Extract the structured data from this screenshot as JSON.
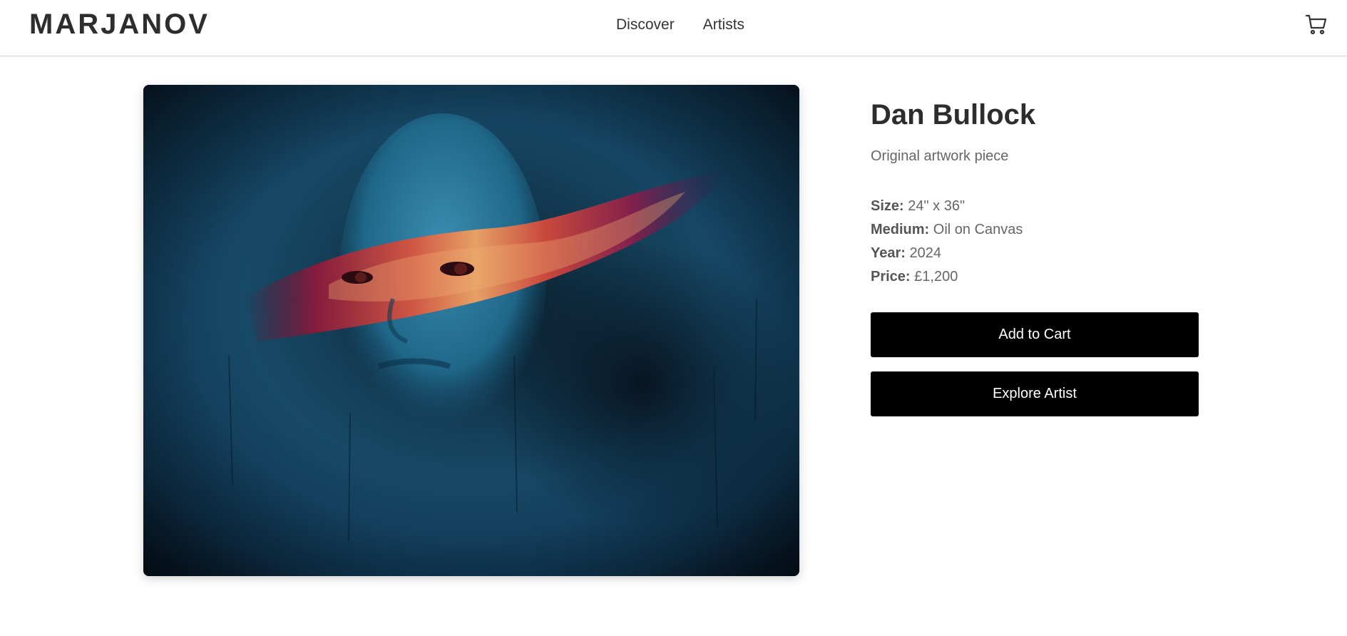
{
  "header": {
    "logo": "MARJANOV",
    "nav": [
      {
        "label": "Discover"
      },
      {
        "label": "Artists"
      }
    ],
    "cart_icon": "shopping-cart-icon"
  },
  "artwork": {
    "subject": "portrait painting"
  },
  "details": {
    "artist_name": "Dan Bullock",
    "subtitle": "Original artwork piece",
    "specs": [
      {
        "label": "Size:",
        "value": "24\" x 36\""
      },
      {
        "label": "Medium:",
        "value": "Oil on Canvas"
      },
      {
        "label": "Year:",
        "value": "2024"
      },
      {
        "label": "Price:",
        "value": "£1,200"
      }
    ],
    "add_to_cart_label": "Add to Cart",
    "explore_artist_label": "Explore Artist"
  },
  "colors": {
    "button_bg": "#000000",
    "button_text": "#ffffff",
    "heading": "#2d2d2d",
    "muted": "#666666"
  }
}
